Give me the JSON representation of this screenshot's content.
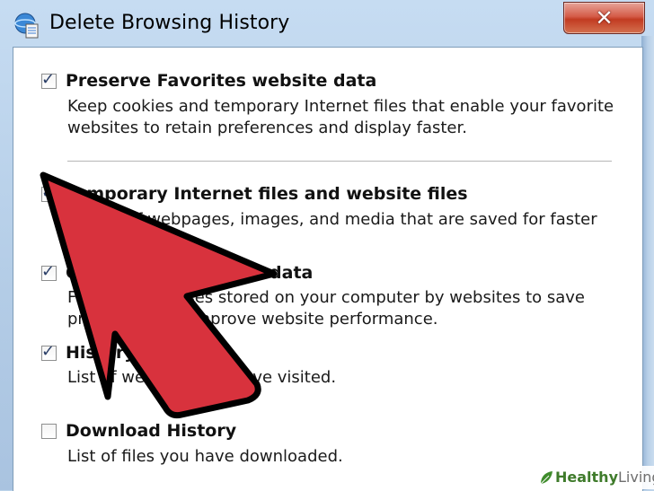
{
  "window": {
    "title": "Delete Browsing History",
    "close_glyph": "✕"
  },
  "options": [
    {
      "checked": true,
      "title": "Preserve Favorites website data",
      "desc": [
        "Keep cookies and temporary Internet files that enable your favorite",
        "websites to retain preferences and display faster."
      ]
    },
    {
      "checked": true,
      "title": "Temporary Internet files and website files",
      "desc": [
        "Copies of webpages, images, and media that are saved for faster"
      ]
    },
    {
      "checked": true,
      "title": "Cookies and website data",
      "desc": [
        "Files or databases stored on your computer by websites to save",
        "preferences or improve website performance."
      ]
    },
    {
      "checked": true,
      "title": "History",
      "desc": [
        "List of websites you have visited."
      ]
    },
    {
      "checked": false,
      "title": "Download History",
      "desc": [
        "List of files you have downloaded."
      ]
    }
  ],
  "watermark": {
    "brand_bold": "Healthy",
    "brand_light": "Living"
  },
  "colors": {
    "arrow_fill": "#d8323d",
    "arrow_stroke": "#000000",
    "close_button": "#c9432a"
  },
  "icons": {
    "title": "ie-history-icon",
    "check": "checkmark-icon",
    "arrow": "pointer-arrow-icon"
  }
}
